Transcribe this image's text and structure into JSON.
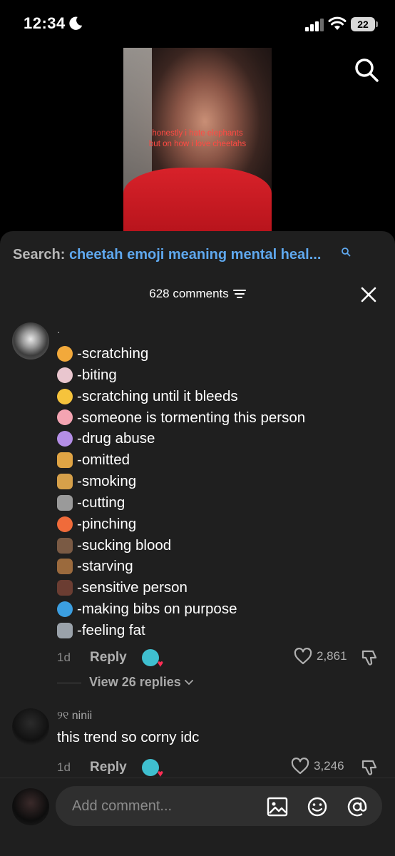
{
  "status_bar": {
    "time": "12:34",
    "battery": "22"
  },
  "video": {
    "caption_line1": "honestly i hate elephants",
    "caption_line2": "but on how i love cheetahs"
  },
  "search": {
    "label": "Search:",
    "query": "cheetah emoji meaning mental heal..."
  },
  "comments_header": {
    "count_text": "628 comments"
  },
  "comments": [
    {
      "username": ".",
      "lines": [
        {
          "icon": "tiger-face-icon",
          "color": "#f2a93b",
          "text": "-scratching"
        },
        {
          "icon": "rabbit-face-icon",
          "color": "#e9c6cf",
          "text": "-biting"
        },
        {
          "icon": "cat-face-icon",
          "color": "#f6c33c",
          "text": "-scratching until it bleeds"
        },
        {
          "icon": "pig-face-icon",
          "color": "#f4a4b2",
          "text": "-someone is tormenting this person"
        },
        {
          "icon": "unicorn-icon",
          "color": "#b48ee6",
          "text": "-drug abuse"
        },
        {
          "icon": "giraffe-icon",
          "color": "#e0a444",
          "text": "-omitted"
        },
        {
          "icon": "leopard-icon",
          "color": "#d6a04a",
          "text": "-smoking"
        },
        {
          "icon": "zebra-icon",
          "color": "#9a9a9a",
          "text": "-cutting"
        },
        {
          "icon": "shrimp-icon",
          "color": "#f06b3a",
          "text": "-pinching"
        },
        {
          "icon": "mosquito-icon",
          "color": "#7a5a44",
          "text": "-sucking blood"
        },
        {
          "icon": "fly-icon",
          "color": "#9b6a3d",
          "text": "-starving"
        },
        {
          "icon": "ant-icon",
          "color": "#6b3d32",
          "text": "-sensitive person"
        },
        {
          "icon": "dolphin-icon",
          "color": "#3b9ee0",
          "text": "-making bibs on purpose"
        },
        {
          "icon": "elephant-icon",
          "color": "#9aa2aa",
          "text": "-feeling fat"
        }
      ],
      "time": "1d",
      "reply_label": "Reply",
      "likes": "2,861",
      "view_replies": "View 26 replies"
    },
    {
      "username": "୨୧ ninii",
      "text": "this trend so corny idc",
      "time": "1d",
      "reply_label": "Reply",
      "likes": "3,246"
    }
  ],
  "input": {
    "placeholder": "Add comment..."
  }
}
